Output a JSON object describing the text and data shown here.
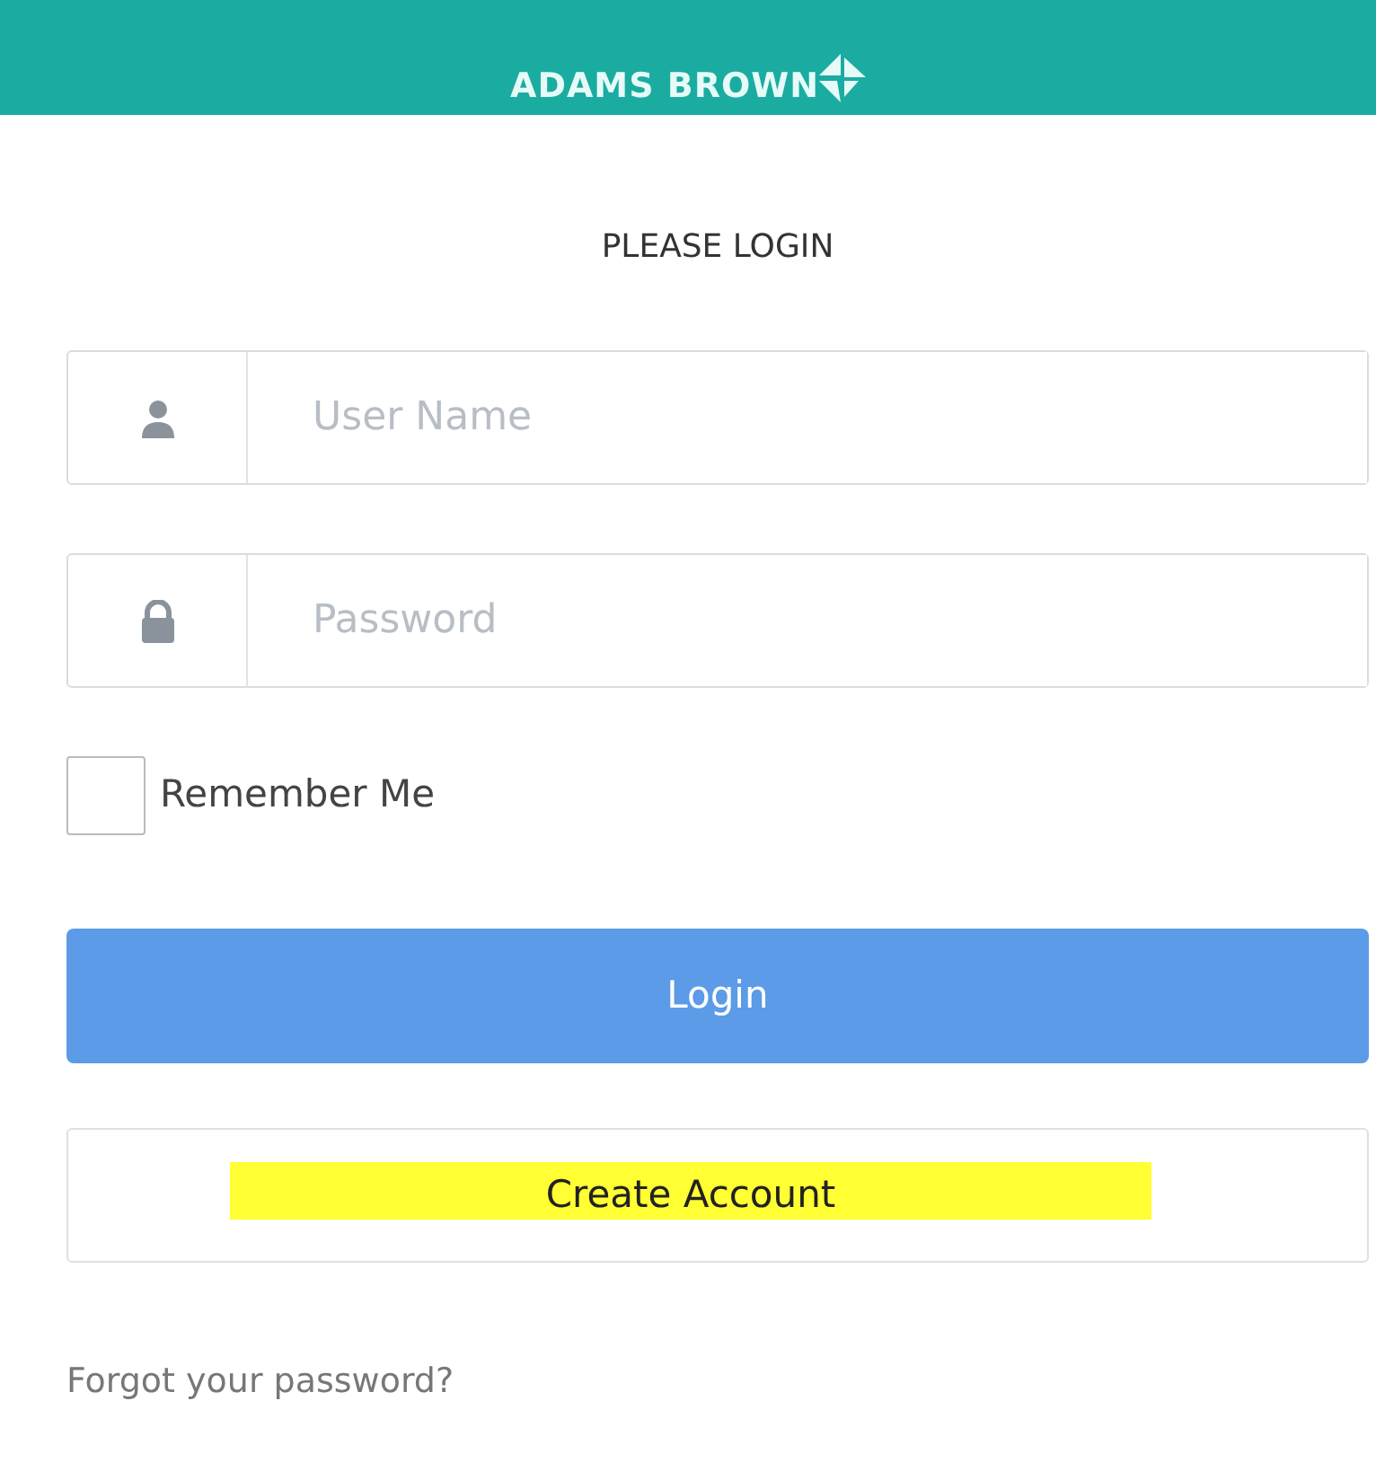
{
  "header": {
    "logo_text": "ADAMS BROWN"
  },
  "title": "PLEASE LOGIN",
  "fields": [
    {
      "kind": "user",
      "placeholder": "User Name"
    },
    {
      "kind": "lock",
      "placeholder": "Password"
    }
  ],
  "remember": {
    "label": "Remember Me",
    "checked": false
  },
  "login_button": "Login",
  "create_account": {
    "label": "Create Account",
    "highlighted": true
  },
  "forgot_link": "Forgot your password?"
}
